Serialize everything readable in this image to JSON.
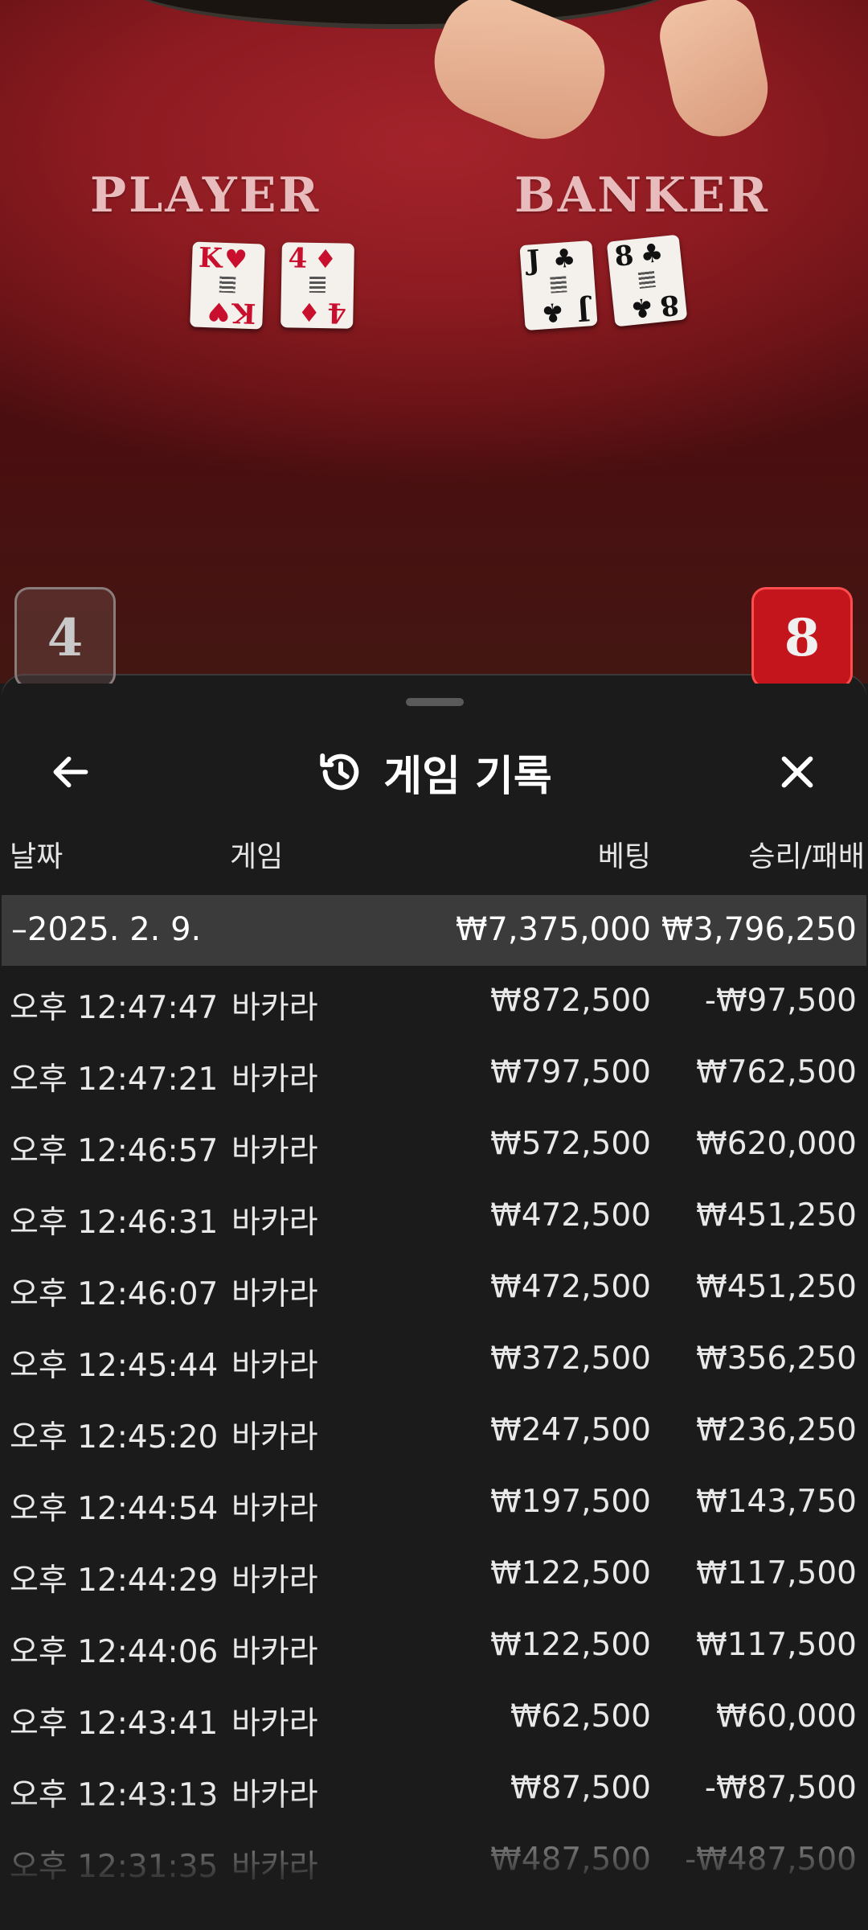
{
  "table": {
    "player_label": "PLAYER",
    "banker_label": "BANKER",
    "player_cards": [
      {
        "rank": "K",
        "suit": "♥",
        "color": "red"
      },
      {
        "rank": "4",
        "suit": "♦",
        "color": "red"
      }
    ],
    "banker_cards": [
      {
        "rank": "J",
        "suit": "♣",
        "color": "blk"
      },
      {
        "rank": "8",
        "suit": "♣",
        "color": "blk"
      }
    ],
    "player_score": "4",
    "banker_score": "8"
  },
  "sheet": {
    "title": "게임 기록",
    "icons": {
      "back": "arrow-left-icon",
      "history": "history-icon",
      "close": "close-icon"
    }
  },
  "columns": {
    "date": "날짜",
    "game": "게임",
    "bet": "베팅",
    "winloss": "승리/패배"
  },
  "date_group": {
    "date": "–2025. 2. 9.",
    "bet_total": "₩7,375,000",
    "winloss_total": "₩3,796,250"
  },
  "rows": [
    {
      "time": "오후 12:47:47",
      "game": "바카라",
      "bet": "₩872,500",
      "winloss": "-₩97,500"
    },
    {
      "time": "오후 12:47:21",
      "game": "바카라",
      "bet": "₩797,500",
      "winloss": "₩762,500"
    },
    {
      "time": "오후 12:46:57",
      "game": "바카라",
      "bet": "₩572,500",
      "winloss": "₩620,000"
    },
    {
      "time": "오후 12:46:31",
      "game": "바카라",
      "bet": "₩472,500",
      "winloss": "₩451,250"
    },
    {
      "time": "오후 12:46:07",
      "game": "바카라",
      "bet": "₩472,500",
      "winloss": "₩451,250"
    },
    {
      "time": "오후 12:45:44",
      "game": "바카라",
      "bet": "₩372,500",
      "winloss": "₩356,250"
    },
    {
      "time": "오후 12:45:20",
      "game": "바카라",
      "bet": "₩247,500",
      "winloss": "₩236,250"
    },
    {
      "time": "오후 12:44:54",
      "game": "바카라",
      "bet": "₩197,500",
      "winloss": "₩143,750"
    },
    {
      "time": "오후 12:44:29",
      "game": "바카라",
      "bet": "₩122,500",
      "winloss": "₩117,500"
    },
    {
      "time": "오후 12:44:06",
      "game": "바카라",
      "bet": "₩122,500",
      "winloss": "₩117,500"
    },
    {
      "time": "오후 12:43:41",
      "game": "바카라",
      "bet": "₩62,500",
      "winloss": "₩60,000"
    },
    {
      "time": "오후 12:43:13",
      "game": "바카라",
      "bet": "₩87,500",
      "winloss": "-₩87,500"
    },
    {
      "time": "오후 12:31:35",
      "game": "바카라",
      "bet": "₩487,500",
      "winloss": "-₩487,500"
    }
  ]
}
